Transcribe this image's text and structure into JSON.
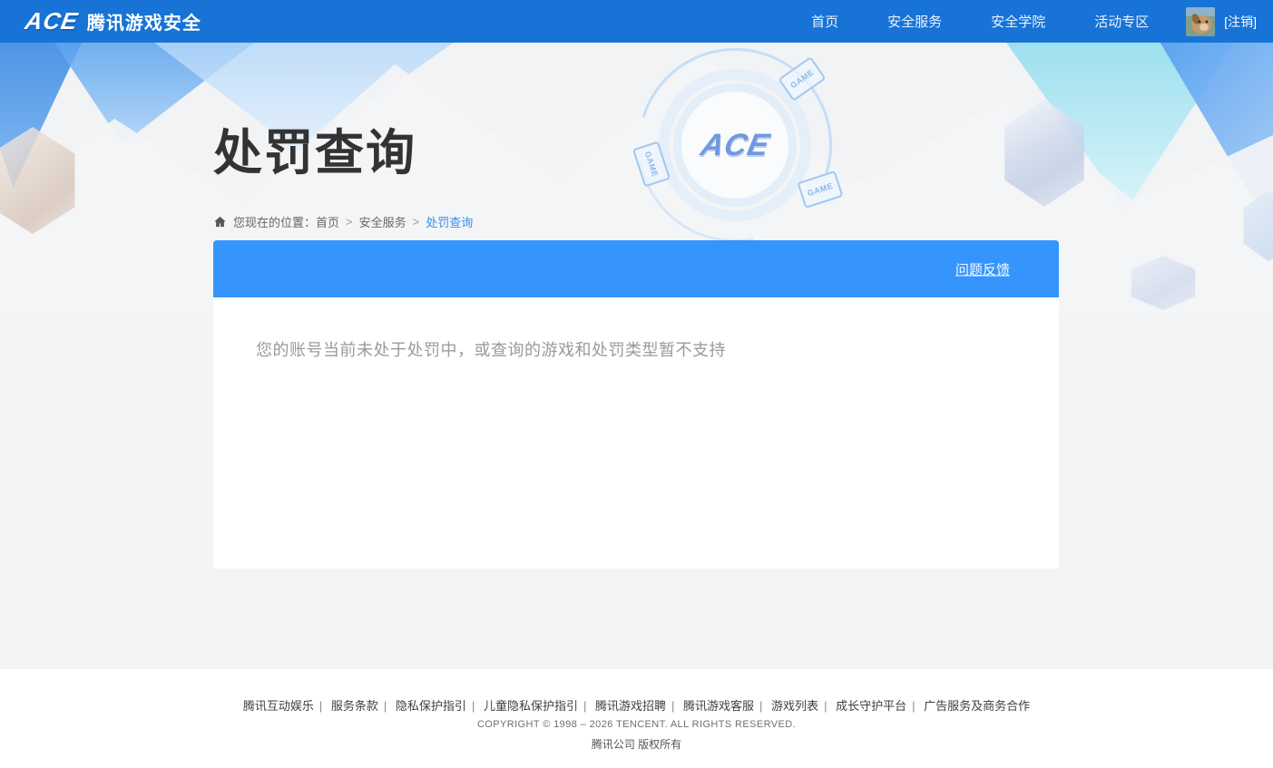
{
  "header": {
    "logo_mark": "ACE",
    "logo_text": "腾讯游戏安全",
    "nav": [
      "首页",
      "安全服务",
      "安全学院",
      "活动专区"
    ],
    "logout_label": "[注销]"
  },
  "hero": {
    "title": "处罚查询",
    "breadcrumb": {
      "label": "您现在的位置：",
      "items": [
        "首页",
        "安全服务",
        "处罚查询"
      ],
      "separator": ">"
    },
    "emblem_text": "ACE",
    "game_chip_label": "GAME"
  },
  "card": {
    "feedback_link": "问题反馈",
    "message": "您的账号当前未处于处罚中，或查询的游戏和处罚类型暂不支持"
  },
  "footer": {
    "links": [
      "腾讯互动娱乐",
      "服务条款",
      "隐私保护指引",
      "儿童隐私保护指引",
      "腾讯游戏招聘",
      "腾讯游戏客服",
      "游戏列表",
      "成长守护平台",
      "广告服务及商务合作"
    ],
    "separator": "|",
    "copyright": "COPYRIGHT © 1998 – 2026 TENCENT. ALL RIGHTS RESERVED.",
    "company": "腾讯公司 版权所有"
  },
  "colors": {
    "header_blue": "#1773d6",
    "banner_blue": "#3595fc",
    "link_blue": "#3b8bee"
  }
}
